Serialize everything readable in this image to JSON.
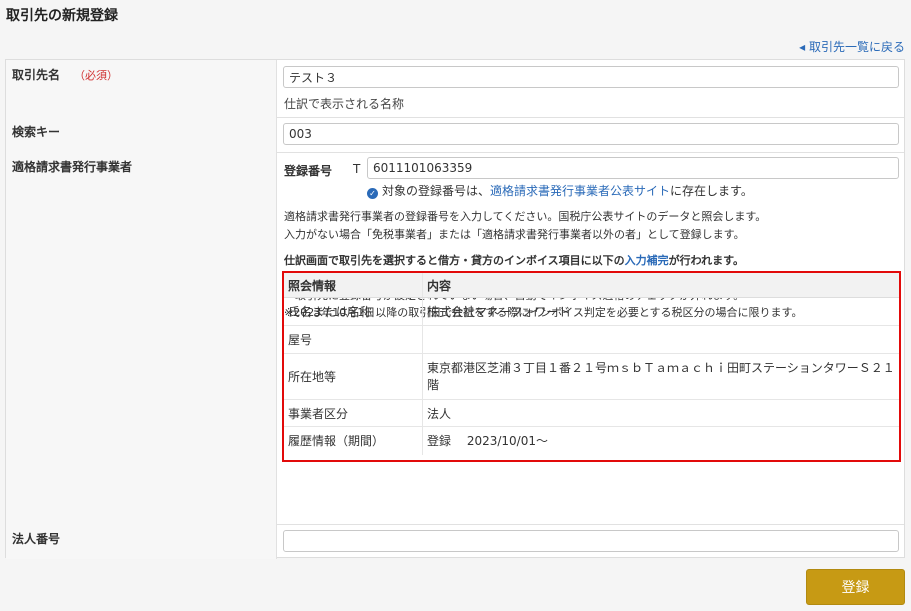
{
  "page": {
    "title": "取引先の新規登録",
    "back_link": "取引先一覧に戻る"
  },
  "colors": {
    "accent": "#2a6ab8",
    "required": "#d03030",
    "highlight_border": "#e20a0a",
    "submit": "#c79a14"
  },
  "form": {
    "name": {
      "label": "取引先名",
      "required": "（必須）",
      "value": "テスト３",
      "help": "仕訳で表示される名称"
    },
    "search_key": {
      "label": "検索キー",
      "value": "003"
    },
    "invoice": {
      "label": "適格請求書発行事業者",
      "reg_label": "登録番号",
      "prefix": "T",
      "value": "6011101063359",
      "status_icon": "check-circle-icon",
      "status_pre": "対象の登録番号は、",
      "status_link": "適格請求書発行事業者公表サイト",
      "status_post": "に存在します。",
      "desc1": "適格請求書発行事業者の登録番号を入力してください。国税庁公表サイトのデータと照会します。",
      "desc2": "入力がない場合「免税事業者」または「適格請求書発行事業者以外の者」として登録します。",
      "note_pre": "仕訳画面で取引先を選択すると借方・貸方のインボイス項目に以下の",
      "note_link": "入力補完",
      "note_post": "が行われます。",
      "bullet1": "・取引先に登録番号が設定されている場合、自動でインボイス適格のチェックが入ります。",
      "bullet2": "・取引先に登録番号が設定されていない場合、自動でインボイス適格のチェックが外れます。",
      "bullet3": "※2023年10月1日以降の取引日で仕訳をする際にインボイス判定を必要とする税区分の場合に限ります。",
      "info": {
        "headers": [
          "照会情報",
          "内容"
        ],
        "rows": [
          [
            "氏名または名称",
            "株式会社マネーフォワード"
          ],
          [
            "屋号",
            ""
          ],
          [
            "所在地等",
            "東京都港区芝浦３丁目１番２１号ｍｓｂＴａｍａｃｈｉ田町ステーションタワーＳ２１階"
          ],
          [
            "事業者区分",
            "法人"
          ],
          [
            "履歴情報（期間）",
            "登録　 2023/10/01〜"
          ]
        ]
      }
    },
    "corp_number": {
      "label": "法人番号",
      "value": ""
    }
  },
  "actions": {
    "submit": "登録"
  }
}
